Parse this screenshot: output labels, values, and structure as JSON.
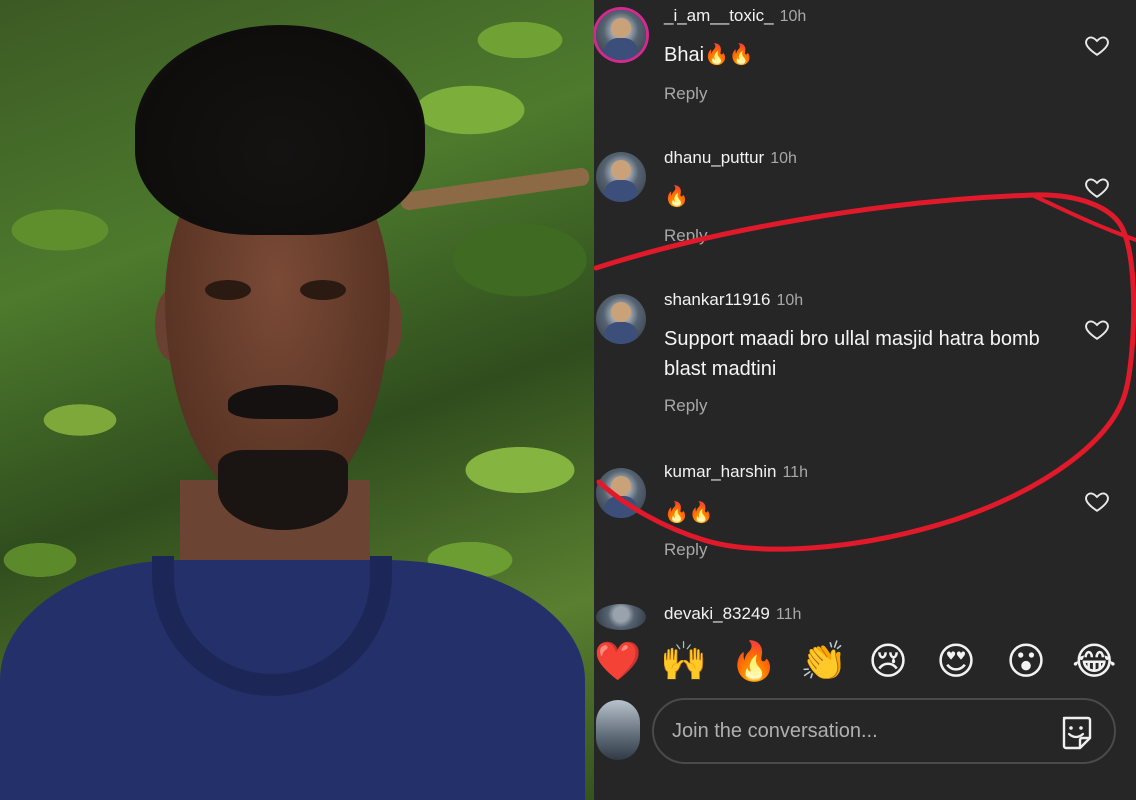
{
  "comments": [
    {
      "username": "_i_am__toxic_",
      "time": "10h",
      "text": "Bhai🔥🔥",
      "reply_label": "Reply",
      "avatar_icon": "avatar-icon",
      "has_story_ring": true
    },
    {
      "username": "dhanu_puttur",
      "time": "10h",
      "text": "🔥",
      "reply_label": "Reply",
      "avatar_icon": "avatar-icon",
      "has_story_ring": false
    },
    {
      "username": "shankar11916",
      "time": "10h",
      "text": "Support maadi bro ullal masjid hatra bomb blast madtini",
      "reply_label": "Reply",
      "avatar_icon": "avatar-icon",
      "has_story_ring": false
    },
    {
      "username": "kumar_harshin",
      "time": "11h",
      "text": "🔥🔥",
      "reply_label": "Reply",
      "avatar_icon": "avatar-icon",
      "has_story_ring": false
    },
    {
      "username": "devaki_83249",
      "time": "11h",
      "avatar_icon": "avatar-icon"
    }
  ],
  "emoji_bar": [
    "❤️",
    "🙌",
    "🔥",
    "👏",
    "😢",
    "😍",
    "😮",
    "😂"
  ],
  "composer": {
    "placeholder": "Join the conversation...",
    "sticker_icon": "sticker-icon"
  },
  "colors": {
    "panel_bg": "#262626",
    "annotation": "#e01a2a",
    "muted_text": "#a8a8a8",
    "story_ring": "#d22a8f"
  }
}
